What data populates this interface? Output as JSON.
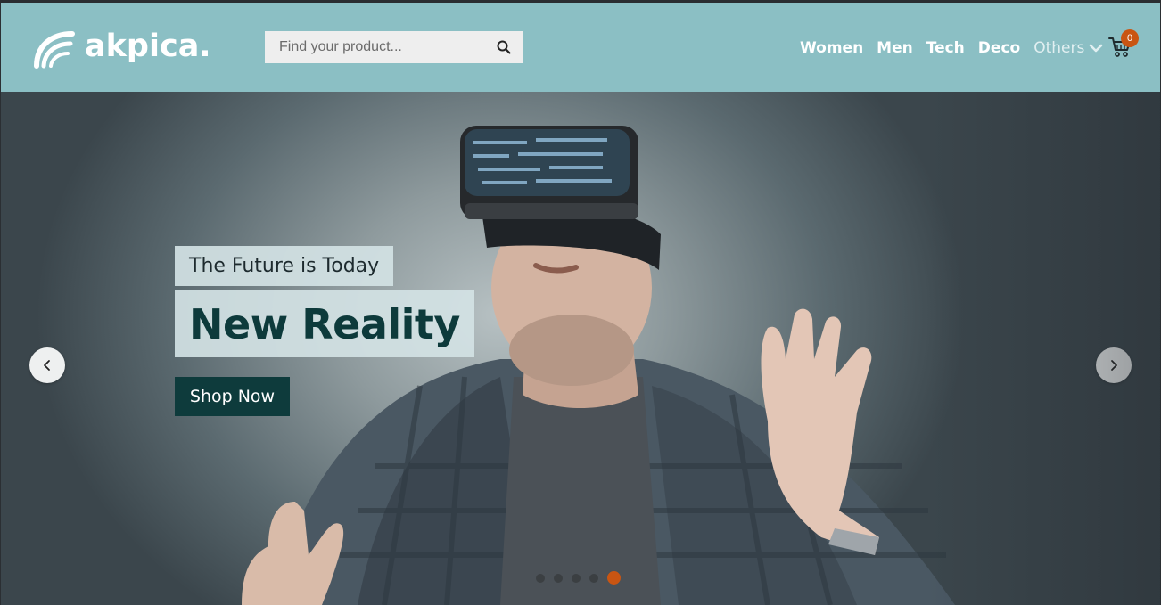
{
  "brand": {
    "name": "akpica."
  },
  "search": {
    "placeholder": "Find your product..."
  },
  "nav": {
    "items": [
      "Women",
      "Men",
      "Tech",
      "Deco"
    ],
    "more_label": "Others"
  },
  "cart": {
    "count": "0"
  },
  "hero": {
    "tagline": "The Future is Today",
    "headline": "New Reality",
    "cta_label": "Shop Now",
    "slides_total": 5,
    "active_slide": 5
  },
  "colors": {
    "header_bg": "#8bbfc4",
    "accent": "#c95512",
    "cta_bg": "#0e3b3c",
    "headline_text": "#0d3a3b"
  },
  "icons": [
    "logo-wave-icon",
    "search-icon",
    "chevron-down-icon",
    "cart-icon",
    "chevron-left-icon",
    "chevron-right-icon"
  ]
}
